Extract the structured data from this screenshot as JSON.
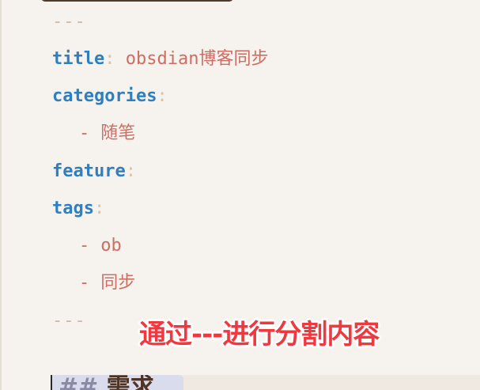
{
  "frontmatter": {
    "open_delimiter": "---",
    "close_delimiter": "---",
    "title_key": "title",
    "title_value": "obsdian博客同步",
    "categories_key": "categories",
    "categories_items": [
      "随笔"
    ],
    "feature_key": "feature",
    "tags_key": "tags",
    "tags_items": [
      "ob",
      "同步"
    ],
    "colon": ":",
    "bullet": "-"
  },
  "annotation": {
    "text": "通过---进行分割内容"
  },
  "next_heading": {
    "marker": "## ",
    "text": "需求"
  }
}
